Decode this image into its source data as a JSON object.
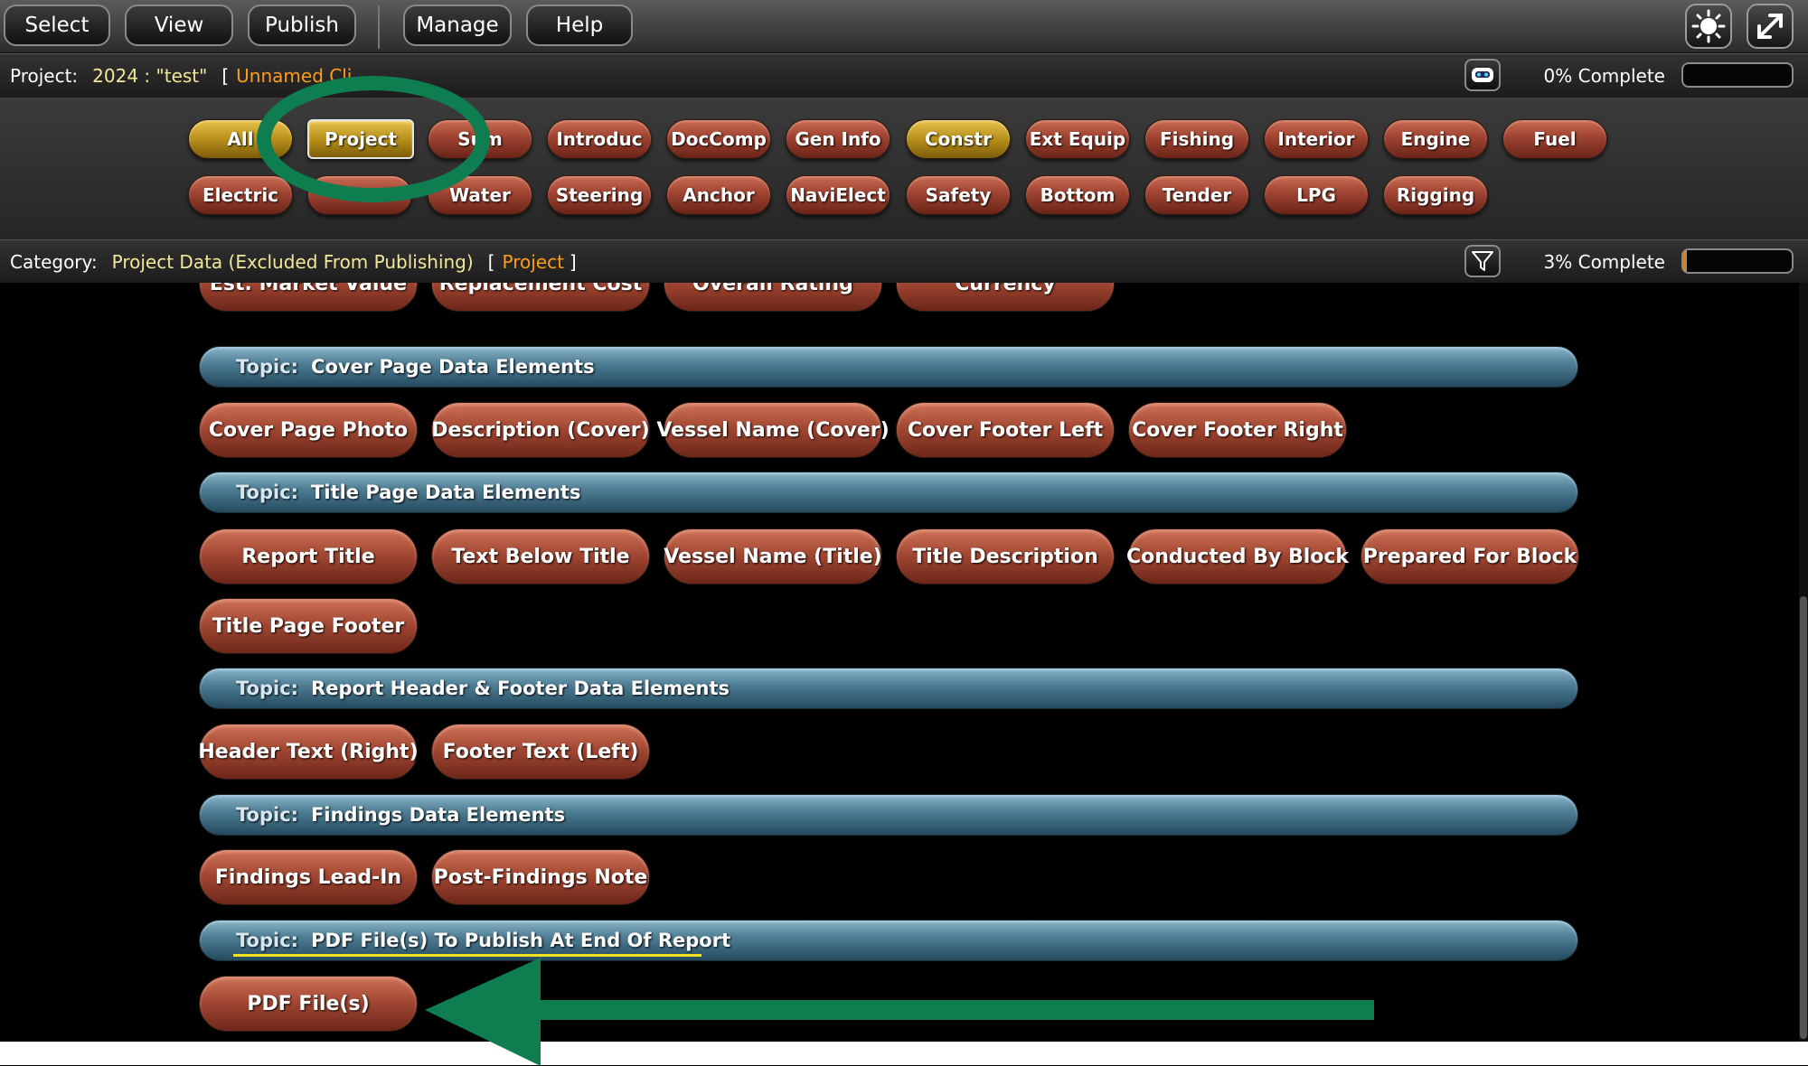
{
  "menu": {
    "select": "Select",
    "view": "View",
    "publish": "Publish",
    "manage": "Manage",
    "help": "Help"
  },
  "project_bar": {
    "label": "Project:",
    "value": "2024 : \"test\"",
    "bracket_open": "[",
    "client": "Unnamed Cli",
    "percent": "0% Complete"
  },
  "categories": {
    "row1": [
      "All",
      "Project",
      "Sum",
      "Introduc",
      "DocComp",
      "Gen Info",
      "Constr",
      "Ext Equip",
      "Fishing",
      "Interior",
      "Engine",
      "Fuel"
    ],
    "row2": [
      "Electric",
      "",
      "Water",
      "Steering",
      "Anchor",
      "NaviElect",
      "Safety",
      "Bottom",
      "Tender",
      "LPG",
      "Rigging"
    ]
  },
  "category_bar": {
    "label": "Category:",
    "value": "Project Data (Excluded From Publishing)",
    "bracket_open": "[",
    "link": "Project",
    "bracket_close": "]",
    "percent": "3% Complete"
  },
  "content": {
    "row_top": [
      "Est. Market Value",
      "Replacement Cost",
      "Overall Rating",
      "Currency"
    ],
    "topic_key": "Topic:",
    "topics": [
      {
        "title": "Cover Page Data Elements",
        "items": [
          "Cover Page Photo",
          "Description (Cover)",
          "Vessel Name (Cover)",
          "Cover Footer Left",
          "Cover Footer Right"
        ]
      },
      {
        "title": "Title Page Data Elements",
        "items": [
          "Report Title",
          "Text Below Title",
          "Vessel Name (Title)",
          "Title Description",
          "Conducted By Block",
          "Prepared For Block",
          "Title Page Footer"
        ]
      },
      {
        "title": "Report Header & Footer Data Elements",
        "items": [
          "Header Text (Right)",
          "Footer Text (Left)"
        ]
      },
      {
        "title": "Findings Data Elements",
        "items": [
          "Findings Lead-In",
          "Post-Findings Note"
        ]
      },
      {
        "title": "PDF File(s) To Publish At End Of Report",
        "items": [
          "PDF File(s)"
        ]
      }
    ]
  },
  "colors": {
    "pill": "#a34833",
    "gold": "#b8901c",
    "topic": "#4f7f96",
    "annotation_green": "#0e7d4f",
    "annotation_yellow": "#f0e020"
  },
  "icons": [
    "brightness-icon",
    "fullscreen-icon",
    "robot-icon",
    "filter-icon"
  ]
}
